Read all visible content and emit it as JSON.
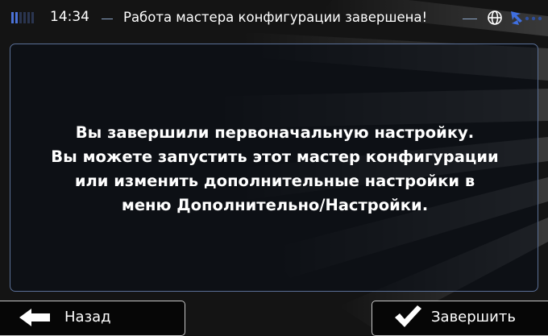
{
  "status_bar": {
    "time": "14:34",
    "title": "Работа мастера конфигурации завершена!",
    "icons": [
      "signal-strength-icon",
      "globe-icon",
      "satellite-icon"
    ]
  },
  "main": {
    "message_lines": [
      "Вы завершили первоначальную настройку.",
      "Вы можете запустить этот мастер конфигурации",
      "или изменить дополнительные настройки в",
      "меню Дополнительно/Настройки."
    ]
  },
  "buttons": {
    "back_label": "Назад",
    "back_icon": "arrow-left-icon",
    "finish_label": "Завершить",
    "finish_icon": "checkmark-icon"
  },
  "colors": {
    "background": "#141414",
    "accent": "#8da6c8",
    "panel_border": "#5a6f96",
    "satellite_icon": "#3f6fe0"
  }
}
